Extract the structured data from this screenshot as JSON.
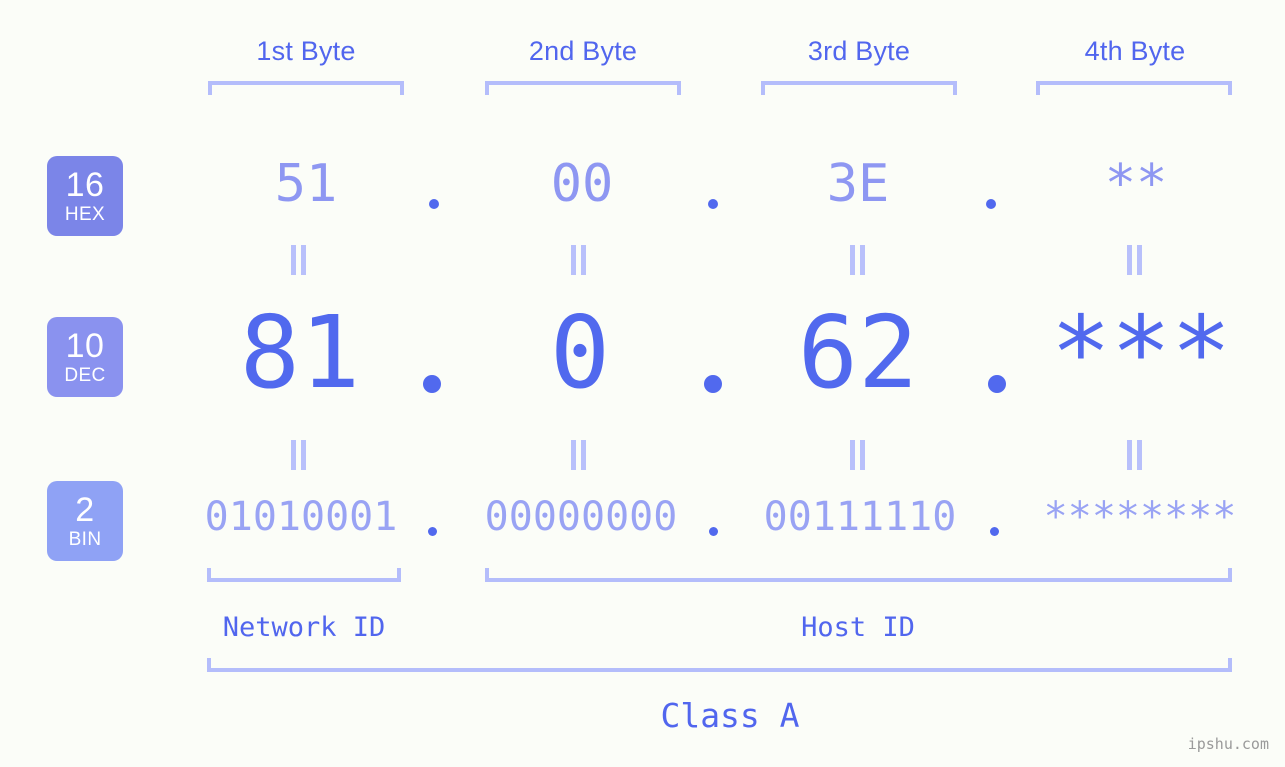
{
  "meta": {
    "background": "#fbfdf8",
    "accent": "#5169ee",
    "accent_light": "#b4bdfb",
    "watermark": "ipshu.com"
  },
  "byte_headers": [
    {
      "label": "1st Byte"
    },
    {
      "label": "2nd Byte"
    },
    {
      "label": "3rd Byte"
    },
    {
      "label": "4th Byte"
    }
  ],
  "bases": [
    {
      "number": "16",
      "name": "HEX",
      "color": "#7b85e8"
    },
    {
      "number": "10",
      "name": "DEC",
      "color": "#8a92ef"
    },
    {
      "number": "2",
      "name": "BIN",
      "color": "#8fa2f5"
    }
  ],
  "rows": {
    "hex": {
      "base_number": "16",
      "base_name": "HEX",
      "octets": [
        "51",
        "00",
        "3E",
        "**"
      ],
      "separator": "."
    },
    "dec": {
      "base_number": "10",
      "base_name": "DEC",
      "octets": [
        "81",
        "0",
        "62",
        "***"
      ],
      "separator": "."
    },
    "bin": {
      "base_number": "2",
      "base_name": "BIN",
      "octets": [
        "01010001",
        "00000000",
        "00111110",
        "********"
      ],
      "separator": "."
    }
  },
  "equals_marks": {
    "glyph": "||",
    "count_per_gap": 4
  },
  "footer": {
    "network_id_label": "Network ID",
    "host_id_label": "Host ID",
    "class_label": "Class A"
  }
}
